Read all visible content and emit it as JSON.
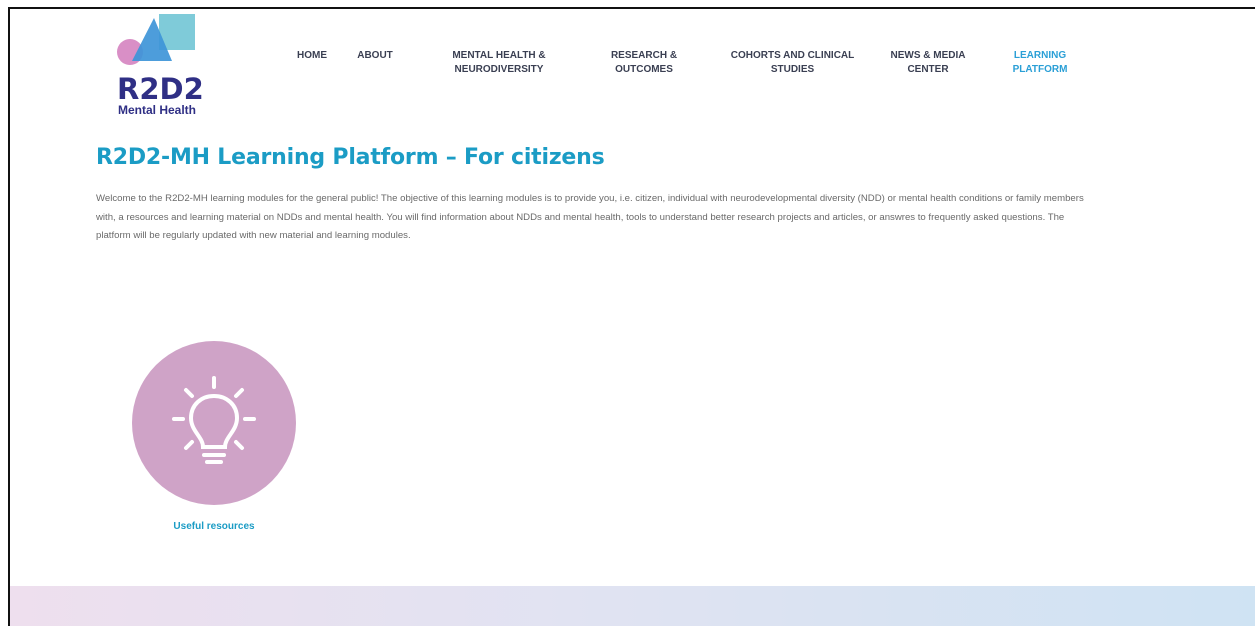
{
  "logo": {
    "title": "R2D2",
    "subtitle": "Mental Health"
  },
  "nav": [
    {
      "label": "HOME"
    },
    {
      "label": "ABOUT"
    },
    {
      "label": "MENTAL HEALTH & NEURODIVERSITY"
    },
    {
      "label": "RESEARCH & OUTCOMES"
    },
    {
      "label": "COHORTS AND CLINICAL STUDIES"
    },
    {
      "label": "NEWS & MEDIA CENTER"
    },
    {
      "label": "LEARNING PLATFORM",
      "active": true
    }
  ],
  "page": {
    "title": "R2D2-MH Learning Platform – For citizens",
    "intro": "Welcome to the R2D2-MH learning modules for the general public! The objective of this learning modules is to provide you, i.e. citizen, individual with neurodevelopmental diversity (NDD) or mental health conditions or family members with, a resources and learning material on NDDs and mental health. You will find information about NDDs and mental health, tools to understand better research projects and articles, or answres to frequently asked questions. The platform will be regularly updated with new material and learning modules."
  },
  "modules": [
    {
      "label": "Useful resources",
      "icon": "lightbulb-icon"
    }
  ],
  "colors": {
    "accent": "#1b9cc5",
    "nav_active": "#2a9fd6",
    "logo_text": "#2f2f85",
    "module_circle": "#cfa3c7"
  }
}
